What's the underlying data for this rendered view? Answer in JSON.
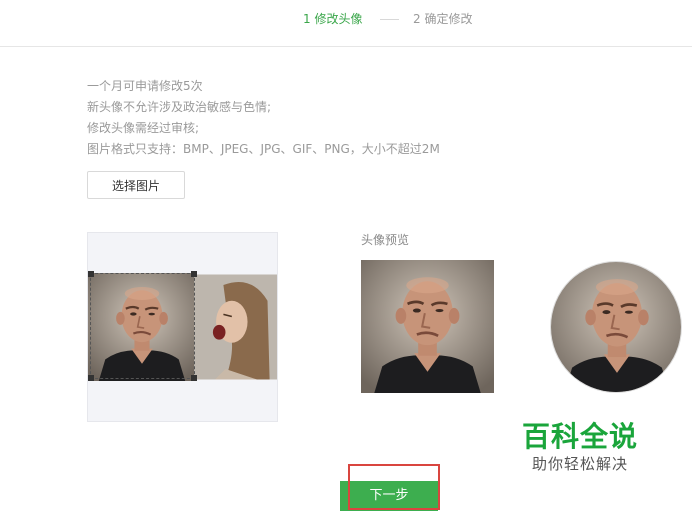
{
  "steps": [
    {
      "label": "1 修改头像",
      "active": true
    },
    {
      "label": "2 确定修改",
      "active": false
    }
  ],
  "rules": [
    "一个月可申请修改5次",
    "新头像不允许涉及政治敏感与色情;",
    "修改头像需经过审核;",
    "图片格式只支持：BMP、JPEG、JPG、GIF、PNG，大小不超过2M"
  ],
  "choose_button": "选择图片",
  "preview": {
    "label": "头像预览"
  },
  "next_button": "下一步",
  "watermark": {
    "title": "百科全说",
    "subtitle": "助你轻松解决"
  },
  "colors": {
    "accent": "#3aa64a",
    "highlight": "#d9453f"
  }
}
